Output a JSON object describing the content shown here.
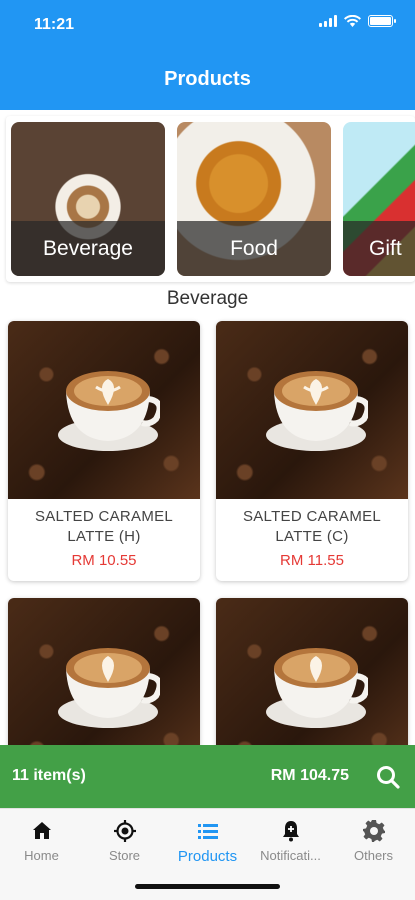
{
  "status_bar": {
    "time": "11:21"
  },
  "header": {
    "title": "Products"
  },
  "categories": [
    {
      "label": "Beverage"
    },
    {
      "label": "Food"
    },
    {
      "label": "Gift"
    }
  ],
  "section": {
    "title": "Beverage"
  },
  "products": [
    {
      "name": "SALTED CARAMEL LATTE (H)",
      "price": "RM 10.55"
    },
    {
      "name": "SALTED CARAMEL LATTE (C)",
      "price": "RM 11.55"
    },
    {
      "name": "",
      "price": ""
    },
    {
      "name": "",
      "price": ""
    }
  ],
  "cart": {
    "items_label": "11 item(s)",
    "total": "RM 104.75",
    "icon": "search-icon"
  },
  "bottom_nav": [
    {
      "label": "Home",
      "icon": "home-icon"
    },
    {
      "label": "Store",
      "icon": "store-locator-icon"
    },
    {
      "label": "Products",
      "icon": "list-icon",
      "active": true
    },
    {
      "label": "Notificati...",
      "icon": "bell-icon"
    },
    {
      "label": "Others",
      "icon": "gear-icon"
    }
  ],
  "colors": {
    "primary": "#2196F3",
    "cart_bar": "#43A047",
    "price": "#E53935"
  }
}
